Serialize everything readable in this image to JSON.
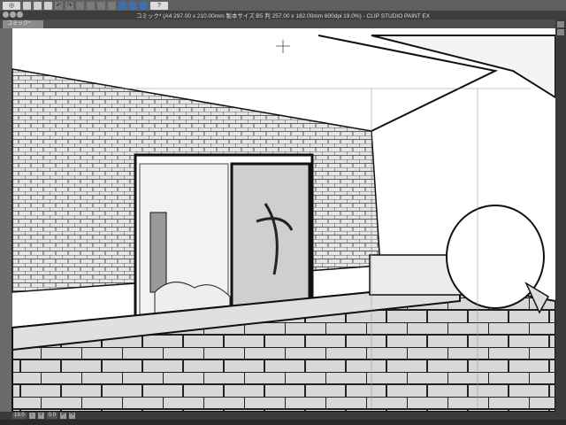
{
  "window": {
    "title": "コミック* (A4 297.00 x 210.00mm 製本サイズ:B5 判 257.00 x 182.00mm 600dpi 19.0%)  - CLIP STUDIO PAINT EX"
  },
  "tabs": [
    {
      "label": "コミック*"
    }
  ],
  "toolbar": {
    "help_label": "?"
  },
  "status": {
    "zoom": "19.0",
    "angle": "0.0"
  },
  "icons": [
    "clip-studio-logo-icon",
    "new-icon",
    "open-icon",
    "save-icon",
    "undo-icon",
    "redo-icon",
    "selection-icon",
    "transform-icon",
    "ruler-snap-icon",
    "help-icon"
  ]
}
